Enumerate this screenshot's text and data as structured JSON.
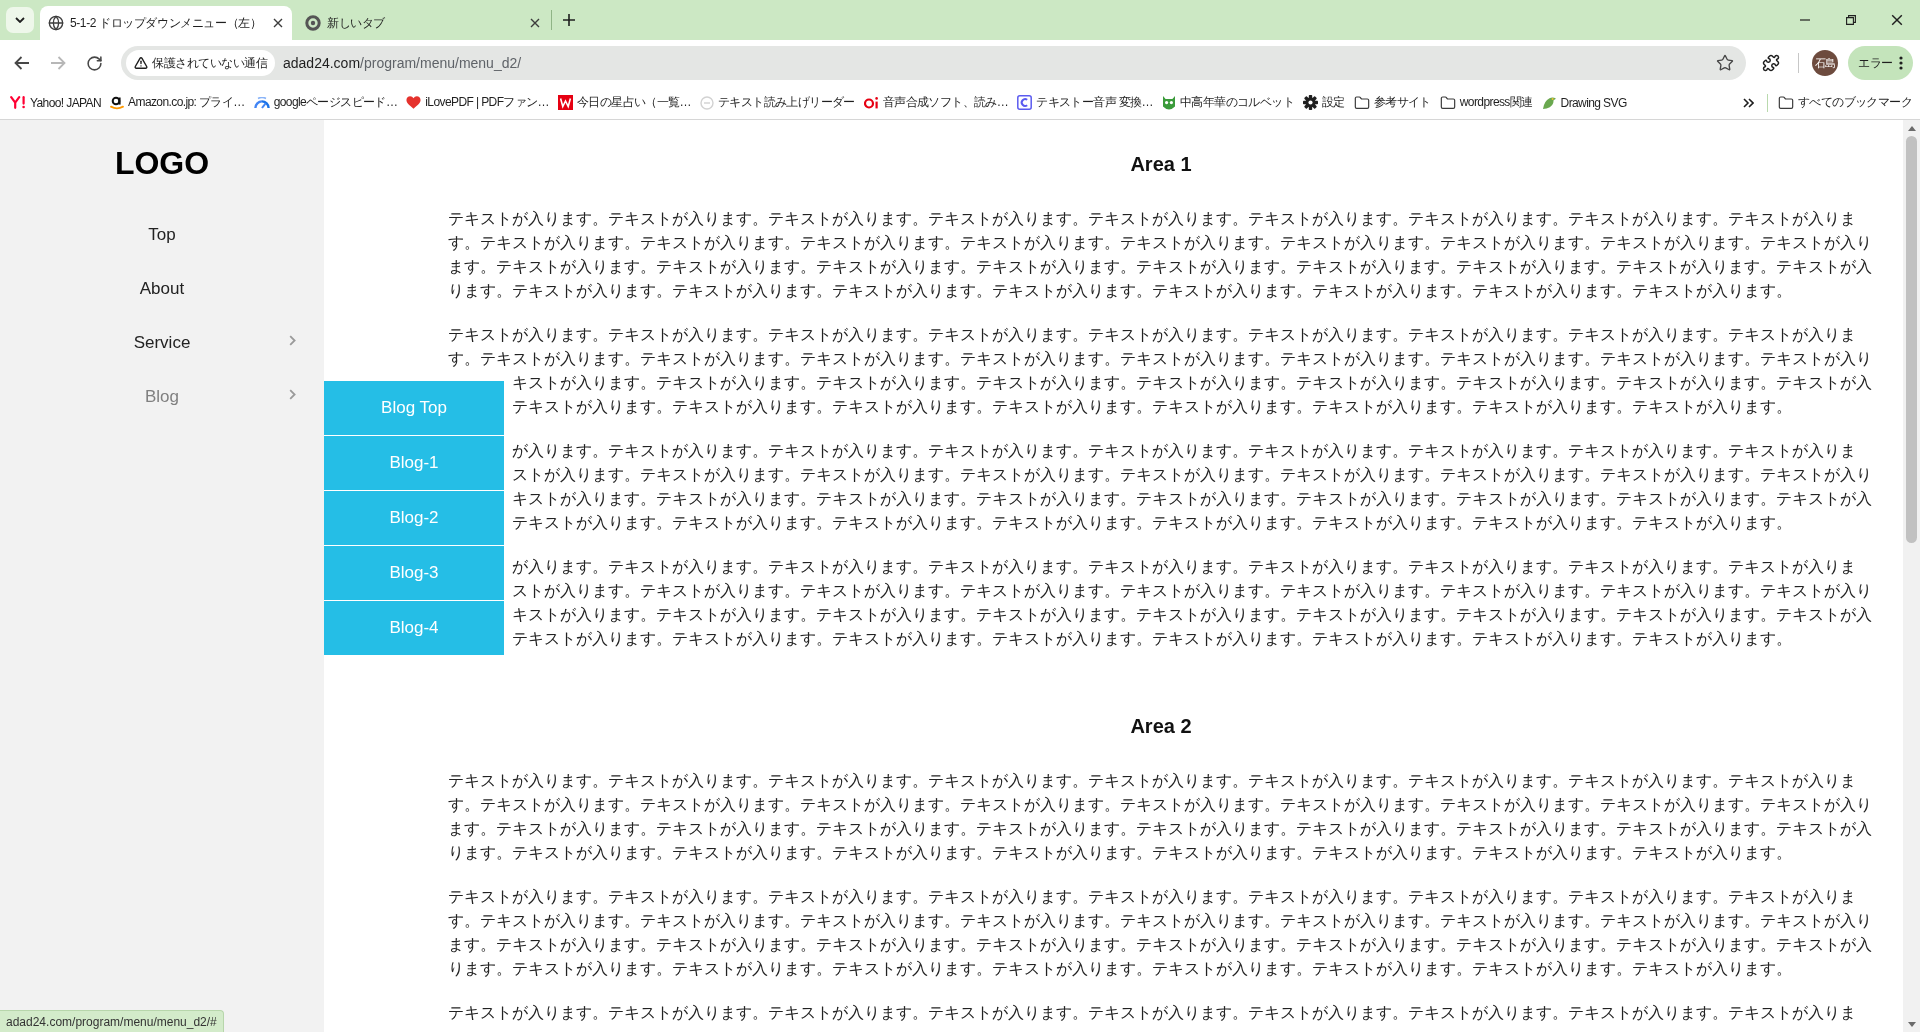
{
  "browser": {
    "tabs": [
      {
        "title": "5-1-2 ドロップダウンメニュー（左）",
        "selected": true
      },
      {
        "title": "新しいタブ",
        "selected": false
      }
    ],
    "nav_buttons": [
      {
        "kind": "back",
        "disabled": false
      },
      {
        "kind": "forward",
        "disabled": true
      },
      {
        "kind": "reload",
        "disabled": false
      }
    ],
    "address_bar": {
      "security_label": "保護されていない通信",
      "host": "adad24.com",
      "path": "/program/menu/menu_d2/"
    },
    "profile": {
      "initials": "石島"
    },
    "menu_button": {
      "label": "エラー"
    },
    "bookmarks": [
      {
        "label": "Yahoo! JAPAN",
        "kind": "site"
      },
      {
        "label": "Amazon.co.jp: プライ…",
        "kind": "site"
      },
      {
        "label": "googleページスピード…",
        "kind": "site"
      },
      {
        "label": "iLovePDF | PDFファン…",
        "kind": "site"
      },
      {
        "label": "今日の星占い（一覧…",
        "kind": "site"
      },
      {
        "label": "テキスト読み上げリーダー",
        "kind": "site"
      },
      {
        "label": "音声合成ソフト、読み…",
        "kind": "site"
      },
      {
        "label": "テキストー音声 変換…",
        "kind": "site"
      },
      {
        "label": "中高年華のコルベット",
        "kind": "site"
      },
      {
        "label": "設定",
        "kind": "site"
      },
      {
        "label": "参考サイト",
        "kind": "folder"
      },
      {
        "label": "wordpress関連",
        "kind": "folder"
      },
      {
        "label": "Drawing SVG",
        "kind": "site"
      }
    ],
    "all_bookmarks": {
      "label": "すべてのブックマーク"
    }
  },
  "sidebar": {
    "logo": "LOGO",
    "items": [
      {
        "label": "Top",
        "has_submenu": false,
        "expanded": false
      },
      {
        "label": "About",
        "has_submenu": false,
        "expanded": false
      },
      {
        "label": "Service",
        "has_submenu": true,
        "expanded": false
      },
      {
        "label": "Blog",
        "has_submenu": true,
        "expanded": true,
        "submenu": [
          {
            "label": "Blog Top"
          },
          {
            "label": "Blog-1"
          },
          {
            "label": "Blog-2"
          },
          {
            "label": "Blog-3"
          },
          {
            "label": "Blog-4"
          }
        ]
      }
    ]
  },
  "main": {
    "areas": [
      {
        "title": "Area 1",
        "paragraphs": [
          {
            "kind": "paragraph",
            "text": "テキストが入ります。テキストが入ります。テキストが入ります。テキストが入ります。テキストが入ります。テキストが入ります。テキストが入ります。テキストが入ります。テキストが入ります。テキストが入ります。テキストが入ります。テキストが入ります。テキストが入ります。テキストが入ります。テキストが入ります。テキストが入ります。テキストが入ります。テキストが入ります。テキストが入ります。テキストが入ります。テキストが入ります。テキストが入ります。テキストが入ります。テキストが入ります。テキストが入ります。テキストが入ります。テキストが入ります。テキストが入ります。テキストが入ります。テキストが入ります。テキストが入ります。テキストが入ります。テキストが入ります。テキストが入ります。テキストが入ります。"
          },
          {
            "kind": "lines",
            "lines": [
              {
                "text": "テキストが入ります。テキストが入ります。テキストが入ります。テキストが入ります。テキストが入ります。テキストが入ります。テキストが入ります。テキストが入ります。テキストが入りま",
                "clipped": false
              },
              {
                "text": "す。テキストが入ります。テキストが入ります。テキストが入ります。テキストが入ります。テキストが入ります。テキストが入ります。テキストが入ります。テキストが入ります。テキストが入り",
                "clipped": false
              },
              {
                "text": "キストが入ります。テキストが入ります。テキストが入ります。テキストが入ります。テキストが入ります。テキストが入ります。テキストが入ります。テキストが入ります。テキストが入",
                "clipped": true
              },
              {
                "text": "テキストが入ります。テキストが入ります。テキストが入ります。テキストが入ります。テキストが入ります。テキストが入ります。テキストが入ります。テキストが入ります。",
                "clipped": true
              }
            ]
          },
          {
            "kind": "lines",
            "lines": [
              {
                "text": "が入ります。テキストが入ります。テキストが入ります。テキストが入ります。テキストが入ります。テキストが入ります。テキストが入ります。テキストが入ります。テキストが入りま",
                "clipped": true
              },
              {
                "text": "ストが入ります。テキストが入ります。テキストが入ります。テキストが入ります。テキストが入ります。テキストが入ります。テキストが入ります。テキストが入ります。テキストが入り",
                "clipped": true
              },
              {
                "text": "キストが入ります。テキストが入ります。テキストが入ります。テキストが入ります。テキストが入ります。テキストが入ります。テキストが入ります。テキストが入ります。テキストが入",
                "clipped": true
              },
              {
                "text": "テキストが入ります。テキストが入ります。テキストが入ります。テキストが入ります。テキストが入ります。テキストが入ります。テキストが入ります。テキストが入ります。",
                "clipped": true
              }
            ]
          },
          {
            "kind": "lines",
            "lines": [
              {
                "text": "が入ります。テキストが入ります。テキストが入ります。テキストが入ります。テキストが入ります。テキストが入ります。テキストが入ります。テキストが入ります。テキストが入りま",
                "clipped": true
              },
              {
                "text": "ストが入ります。テキストが入ります。テキストが入ります。テキストが入ります。テキストが入ります。テキストが入ります。テキストが入ります。テキストが入ります。テキストが入り",
                "clipped": true
              },
              {
                "text": "キストが入ります。テキストが入ります。テキストが入ります。テキストが入ります。テキストが入ります。テキストが入ります。テキストが入ります。テキストが入ります。テキストが入",
                "clipped": true
              },
              {
                "text": "テキストが入ります。テキストが入ります。テキストが入ります。テキストが入ります。テキストが入ります。テキストが入ります。テキストが入ります。テキストが入ります。",
                "clipped": true
              }
            ]
          }
        ]
      },
      {
        "title": "Area 2",
        "paragraphs": [
          {
            "kind": "paragraph",
            "text": "テキストが入ります。テキストが入ります。テキストが入ります。テキストが入ります。テキストが入ります。テキストが入ります。テキストが入ります。テキストが入ります。テキストが入ります。テキストが入ります。テキストが入ります。テキストが入ります。テキストが入ります。テキストが入ります。テキストが入ります。テキストが入ります。テキストが入ります。テキストが入ります。テキストが入ります。テキストが入ります。テキストが入ります。テキストが入ります。テキストが入ります。テキストが入ります。テキストが入ります。テキストが入ります。テキストが入ります。テキストが入ります。テキストが入ります。テキストが入ります。テキストが入ります。テキストが入ります。テキストが入ります。テキストが入ります。テキストが入ります。"
          },
          {
            "kind": "paragraph",
            "text": "テキストが入ります。テキストが入ります。テキストが入ります。テキストが入ります。テキストが入ります。テキストが入ります。テキストが入ります。テキストが入ります。テキストが入ります。テキストが入ります。テキストが入ります。テキストが入ります。テキストが入ります。テキストが入ります。テキストが入ります。テキストが入ります。テキストが入ります。テキストが入ります。テキストが入ります。テキストが入ります。テキストが入ります。テキストが入ります。テキストが入ります。テキストが入ります。テキストが入ります。テキストが入ります。テキストが入ります。テキストが入ります。テキストが入ります。テキストが入ります。テキストが入ります。テキストが入ります。テキストが入ります。テキストが入ります。テキストが入ります。"
          },
          {
            "kind": "paragraph",
            "text": "テキストが入ります。テキストが入ります。テキストが入ります。テキストが入ります。テキストが入ります。テキストが入ります。テキストが入ります。テキストが入ります。テキストが入りま"
          }
        ]
      }
    ]
  },
  "status_bubble": {
    "url": "adad24.com/program/menu/menu_d2/#"
  }
}
